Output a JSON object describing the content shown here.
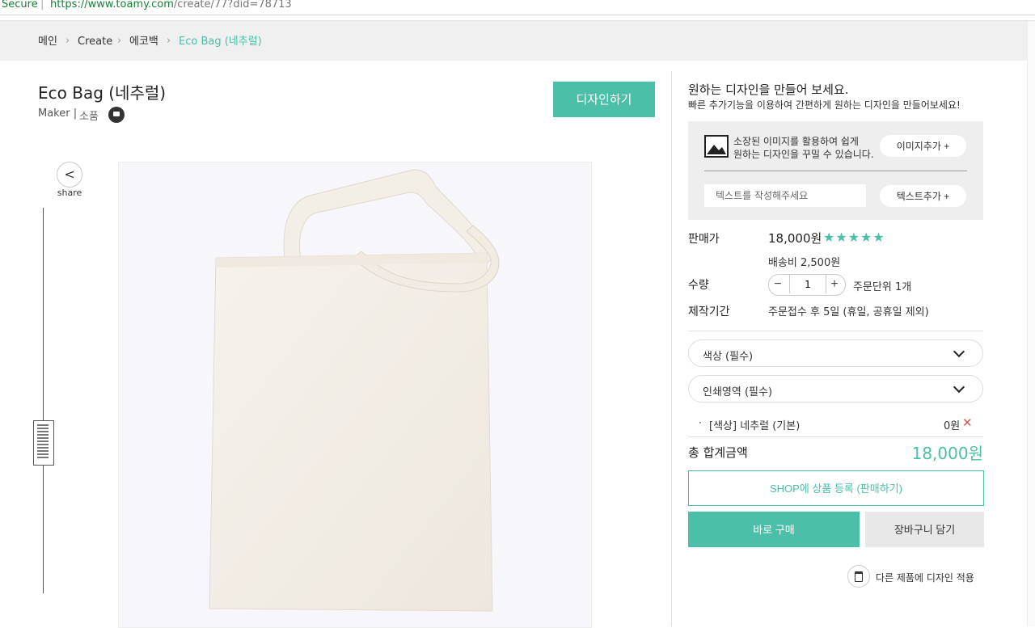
{
  "browser": {
    "secure_label": "Secure",
    "separator": "|",
    "url_base": "https://www.toamy.com",
    "url_path": "/create/77?did=78713"
  },
  "breadcrumb": {
    "items": [
      {
        "label": "메인"
      },
      {
        "label": "Create"
      },
      {
        "label": "에코백"
      },
      {
        "label": "Eco Bag (네추럴)"
      }
    ],
    "separator": "›"
  },
  "product": {
    "title": "Eco Bag (네추럴)",
    "maker_label": "Maker |",
    "seller": "소품",
    "design_button": "디자인하기"
  },
  "share": {
    "icon_glyph": "<",
    "label": "share"
  },
  "panel": {
    "heading": "원하는 디자인을 만들어 보세요.",
    "subheading": "빠른 추가기능을 이용하여 간편하게 원하는 디자인을 만들어보세요!",
    "image_tool": {
      "desc_line1": "소장된 이미지를 활용하여 쉽게",
      "desc_line2": "원하는 디자인을 꾸밀 수 있습니다.",
      "button": "이미지추가 +"
    },
    "text_tool": {
      "placeholder": "텍스트를 작성해주세요",
      "value": "",
      "button": "텍스트추가 +"
    }
  },
  "info": {
    "price_label": "판매가",
    "price": "18,000원",
    "stars": "★★★★★",
    "rating": 5,
    "shipping": "배송비 2,500원",
    "qty_label": "수량",
    "qty_minus": "−",
    "qty_value": "1",
    "qty_plus": "+",
    "qty_unit": "주문단위 1개",
    "production_label": "제작기간",
    "production": "주문접수 후 5일 (휴일, 공휴일 제외)"
  },
  "options": {
    "color_select": "색상 (필수)",
    "print_select": "인쇄영역 (필수)",
    "selected": [
      {
        "bullet": "·",
        "label": "[색상] 네추럴 (기본)",
        "price": "0원",
        "remove": "✕"
      }
    ]
  },
  "total": {
    "label": "총 합계금액",
    "value": "18,000원"
  },
  "actions": {
    "shop_register": "SHOP에 상품 등록 (판매하기)",
    "buy_now": "바로 구매",
    "add_cart": "장바구니 담기",
    "apply_other": "다른 제품에 디자인 적용"
  },
  "colors": {
    "accent": "#4bbfa8",
    "remove": "#d9534f"
  }
}
